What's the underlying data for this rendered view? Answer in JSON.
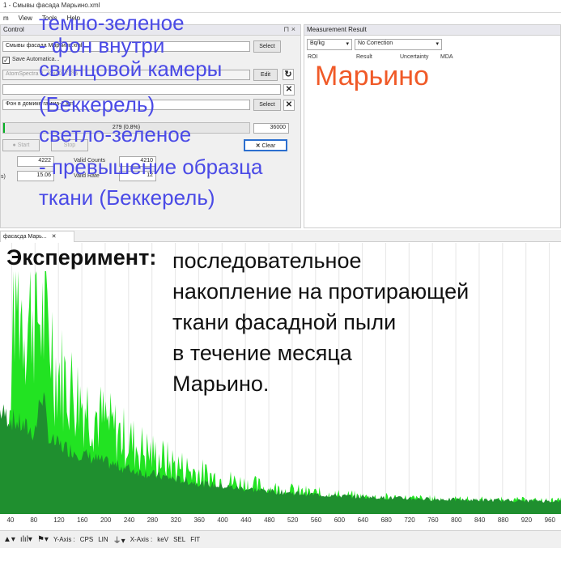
{
  "window": {
    "title": "1 - Смывы фасада Марьино.xml"
  },
  "menu": [
    "m",
    "View",
    "Tools",
    "Help"
  ],
  "control_panel": {
    "title": "Control",
    "spectrum_file": "Смывы фасада Марьино.xml",
    "select_label": "Select",
    "save_auto_label": "Save Automatica...",
    "device_field": "AtomSpectra 2, 40x40, 7.2%",
    "edit_label": "Edit",
    "background_file": "Фон в домике гамма-2.xml",
    "progress_text": "279 (0.8%)",
    "progress_fraction": 0.008,
    "time_target": "36000",
    "start_label": "Start",
    "stop_label": "Stop",
    "clear_label": "Clear",
    "counts_value": "4222",
    "valid_counts_label": "Valid Counts",
    "valid_counts_value": "4210",
    "rate_prefix": "s)",
    "rate_value": "15.06",
    "valid_rate_label": "Valid Rate",
    "valid_rate_value": "12"
  },
  "measurement_panel": {
    "title": "Measurement Result",
    "unit": "Bq/kg",
    "correction": "No Correction",
    "columns": [
      "ROI",
      "Result",
      "Uncertainty",
      "MDA"
    ]
  },
  "overlay": {
    "marino": "Марьино",
    "legend_lines": [
      "темно-зеленое",
      "- фон внутри",
      "свинцовой камеры",
      "(Беккерель)",
      "светло-зеленое",
      "- превышение образца",
      "ткани (Беккерель)"
    ],
    "experiment_label": "Эксперимент:",
    "experiment_lines": [
      "последовательное",
      "накопление на протирающей",
      "ткани фасадной пыли",
      "в течение месяца",
      "Марьино."
    ]
  },
  "tab": {
    "label": "фасасда Марь..."
  },
  "chart_data": {
    "type": "area",
    "xlabel": "",
    "ylabel": "",
    "xlim": [
      20,
      980
    ],
    "ticks": [
      40,
      80,
      120,
      160,
      200,
      240,
      280,
      320,
      360,
      400,
      440,
      480,
      520,
      560,
      600,
      640,
      680,
      720,
      760,
      800,
      840,
      880,
      920,
      960
    ],
    "series": [
      {
        "role": "sample",
        "color": "#22e322"
      },
      {
        "role": "background",
        "color": "#1f8f2f"
      }
    ],
    "colors": {
      "grid": "#e6e6e6"
    }
  },
  "toolbar": {
    "y_axis_label": "Y-Axis :",
    "y_unit": "CPS",
    "x_axis_label": "X-Axis :",
    "x_unit": "keV",
    "lin_label": "LIN",
    "sel_label": "SEL",
    "fit_label": "FIT"
  }
}
